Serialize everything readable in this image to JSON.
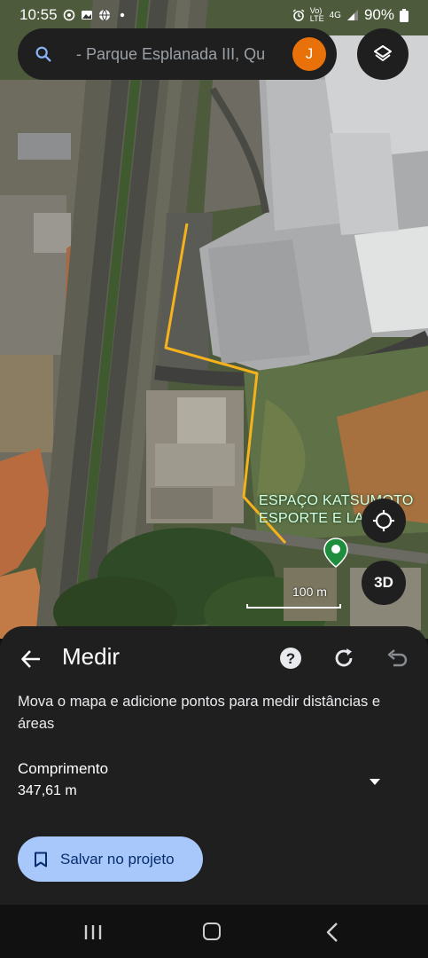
{
  "status_bar": {
    "time": "10:55",
    "network_top": "Vo)",
    "network_bottom": "LTE",
    "network_type": "4G",
    "battery": "90%",
    "icons": [
      "whatsapp-icon",
      "image-icon",
      "globe-icon",
      "dot-icon",
      "alarm-icon",
      "signal-icon",
      "battery-icon"
    ]
  },
  "search": {
    "text": "- Parque Esplanada III, Qu",
    "avatar_letter": "J",
    "avatar_color": "#e8710a"
  },
  "map": {
    "place_label_line1": "ESPAÇO KATSUMOTO",
    "place_label_line2": "ESPORTE E LAZ",
    "pin_color": "#1e8e3e",
    "measure_line_color": "#f5b21c",
    "scale_text": "100 m",
    "three_d_label": "3D"
  },
  "sheet": {
    "title": "Medir",
    "instructions": "Mova o mapa e adicione pontos para medir distâncias e áreas",
    "length_label": "Comprimento",
    "length_value": "347,61 m",
    "save_label": "Salvar no projeto",
    "save_color": "#a8c7fa"
  },
  "nav": {
    "icons": [
      "recent-apps-icon",
      "home-icon",
      "back-icon"
    ]
  }
}
